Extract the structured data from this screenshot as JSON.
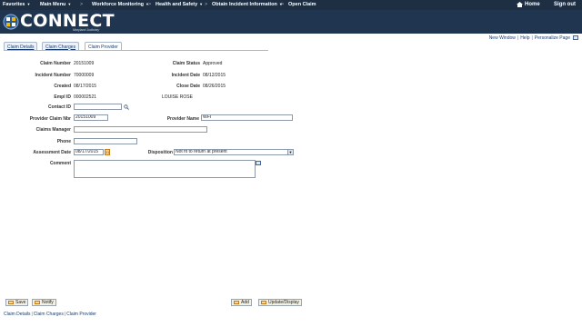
{
  "topnav": {
    "items": [
      {
        "label": "Favorites",
        "caret": "▼"
      },
      {
        "label": "Main Menu",
        "caret": "▼"
      },
      {
        "label": "Workforce Monitoring",
        "caret": "▼"
      },
      {
        "label": "Health and Safety",
        "caret": "▼"
      },
      {
        "label": "Obtain Incident Information",
        "caret": "▼"
      },
      {
        "label": "Open Claim",
        "caret": ""
      }
    ],
    "separator": ">",
    "home_label": "Home",
    "signout_label": "Sign out"
  },
  "banner": {
    "logo_text": "CONNECT",
    "logo_sub": "Maryland Judiciary"
  },
  "pagelinks": {
    "new_window": "New Window",
    "help": "Help",
    "personalize": "Personalize Page",
    "separator": "|"
  },
  "tabs": [
    {
      "label": "Claim Details",
      "active": false
    },
    {
      "label": "Claim Charges",
      "active": false
    },
    {
      "label": "Claim Provider",
      "active": true
    }
  ],
  "form": {
    "claim_number_label": "Claim Number",
    "claim_number_value": "20151009",
    "claim_status_label": "Claim Status",
    "claim_status_value": "Approved",
    "incident_number_label": "Incident Number",
    "incident_number_value": "70000009",
    "incident_date_label": "Incident Date",
    "incident_date_value": "08/12/2015",
    "created_label": "Created",
    "created_value": "08/17/2015",
    "close_date_label": "Close Date",
    "close_date_value": "08/26/2015",
    "empl_id_label": "Empl ID",
    "empl_id_value": "000002521",
    "empl_name_value": "LOUISE ROSE",
    "contact_id_label": "Contact ID",
    "contact_id_value": "",
    "provider_claim_nbr_label": "Provider Claim Nbr",
    "provider_claim_nbr_value": "20151009",
    "provider_name_label": "Provider Name",
    "provider_name_value": "WFI",
    "claims_manager_label": "Claims Manager",
    "claims_manager_value": "",
    "phone_label": "Phone",
    "phone_value": "",
    "assessment_date_label": "Assessment Date",
    "assessment_date_value": "08/17/2015",
    "disposition_label": "Disposition",
    "disposition_value": "Not fit to return at present",
    "comment_label": "Comment",
    "comment_value": ""
  },
  "toolbar": {
    "save_label": "Save",
    "notify_label": "Notify",
    "add_label": "Add",
    "update_display_label": "Update/Display"
  },
  "footer": {
    "links": [
      "Claim Details",
      "Claim Charges",
      "Claim Provider"
    ],
    "separator": "|"
  },
  "colors": {
    "nav_bg": "#1e2f44",
    "banner_bg": "#1f3550",
    "link": "#1a3b6e"
  }
}
